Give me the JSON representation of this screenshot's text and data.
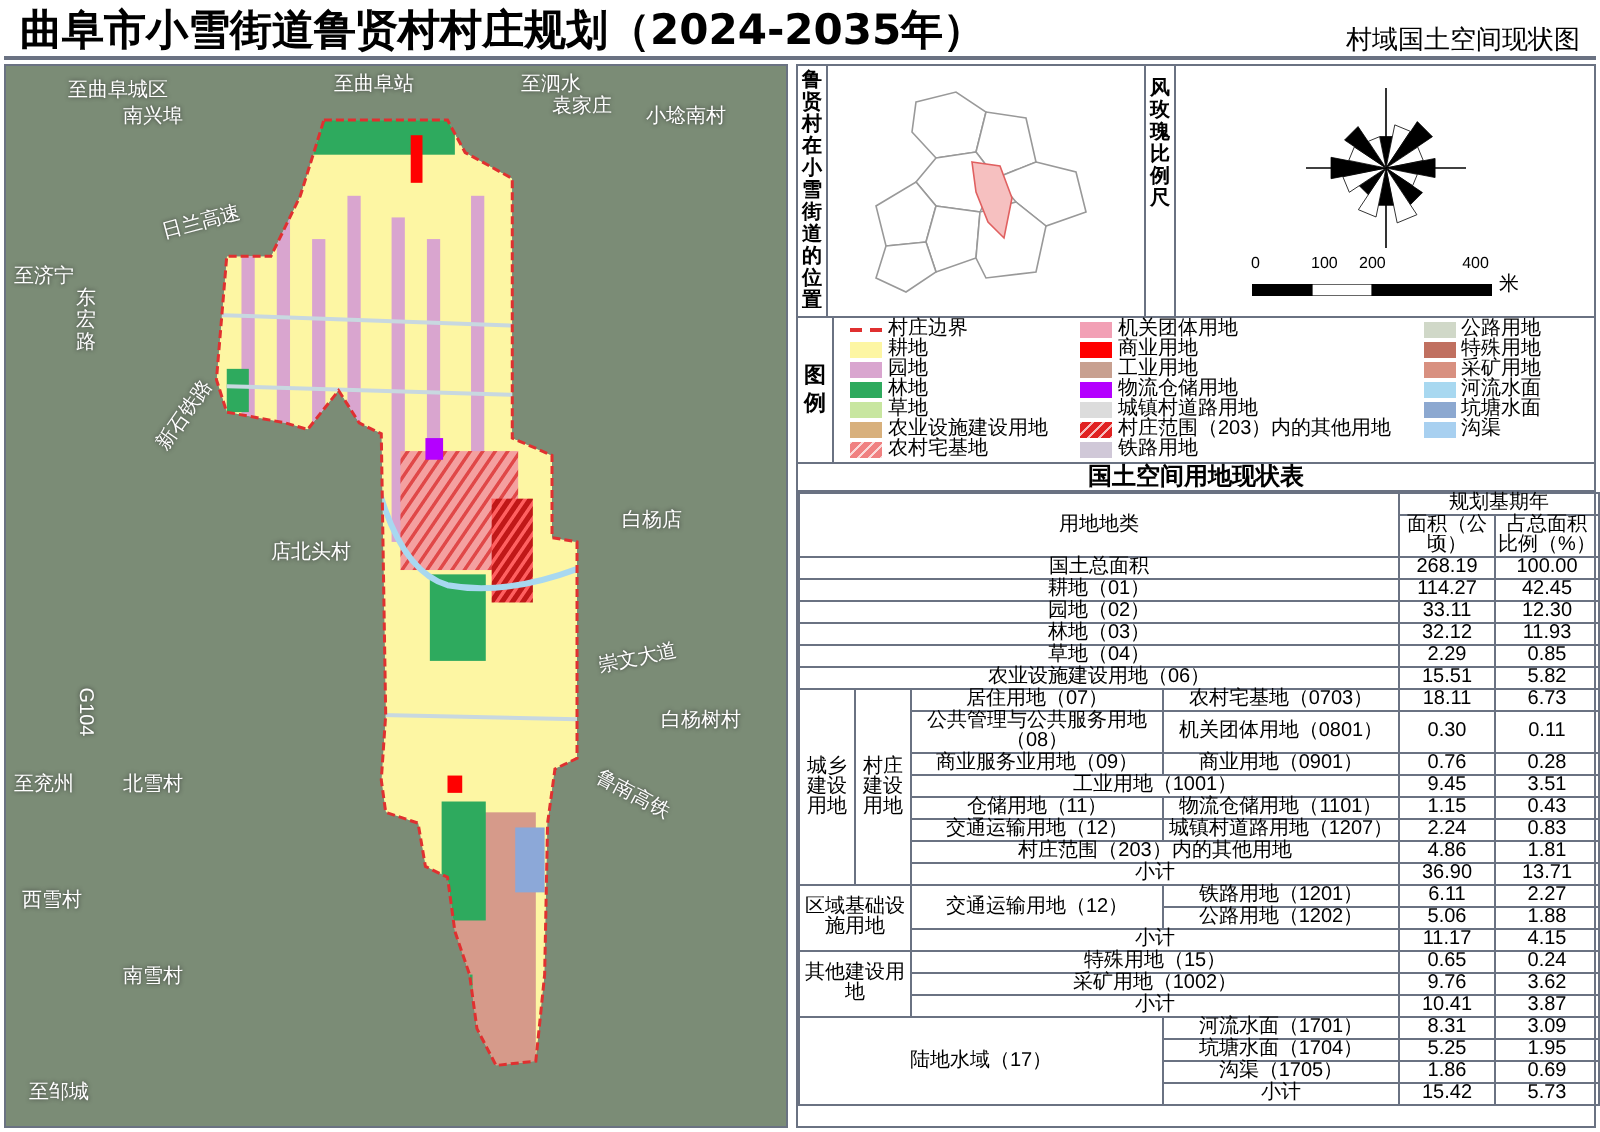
{
  "header": {
    "title": "曲阜市小雪街道鲁贤村村庄规划（2024-2035年）",
    "subtitle": "村域国土空间现状图"
  },
  "map": {
    "labels": [
      "至曲阜城区",
      "南兴埠",
      "至曲阜站",
      "至泗水",
      "袁家庄",
      "小埝南村",
      "日兰高速",
      "至济宁",
      "东宏路",
      "新石铁路",
      "店北头村",
      "白杨店",
      "崇文大道",
      "白杨树村",
      "鲁南高铁",
      "G104",
      "至兖州",
      "北雪村",
      "西雪村",
      "南雪村",
      "至邹城"
    ]
  },
  "locator": {
    "title": "鲁贤村在小雪街道的位置"
  },
  "scale": {
    "title": "风玫瑰比例尺",
    "ticks": [
      "0",
      "100",
      "200",
      "400"
    ],
    "unit": "米"
  },
  "legend": {
    "title": "图例",
    "items": [
      {
        "label": "村庄边界",
        "kind": "boundary",
        "color": "#e03030"
      },
      {
        "label": "耕地",
        "kind": "fill",
        "color": "#fdf6a3"
      },
      {
        "label": "园地",
        "kind": "fill",
        "color": "#d9a5cf"
      },
      {
        "label": "林地",
        "kind": "fill",
        "color": "#2eaa5e"
      },
      {
        "label": "草地",
        "kind": "fill",
        "color": "#c8e6a0"
      },
      {
        "label": "农业设施建设用地",
        "kind": "fill",
        "color": "#d8b07c"
      },
      {
        "label": "农村宅基地",
        "kind": "hatch",
        "color": "#f08080"
      },
      {
        "label": "机关团体用地",
        "kind": "fill",
        "color": "#f2a0b5"
      },
      {
        "label": "商业用地",
        "kind": "fill",
        "color": "#ff0000"
      },
      {
        "label": "工业用地",
        "kind": "fill",
        "color": "#c8a090"
      },
      {
        "label": "物流仓储用地",
        "kind": "fill",
        "color": "#b400ff"
      },
      {
        "label": "城镇村道路用地",
        "kind": "fill",
        "color": "#dcdcdc"
      },
      {
        "label": "村庄范围（203）内的其他用地",
        "kind": "hatch",
        "color": "#e02020"
      },
      {
        "label": "铁路用地",
        "kind": "fill",
        "color": "#d0c8d8"
      },
      {
        "label": "公路用地",
        "kind": "fill",
        "color": "#d0d8c8"
      },
      {
        "label": "特殊用地",
        "kind": "fill",
        "color": "#c07060"
      },
      {
        "label": "采矿用地",
        "kind": "fill",
        "color": "#d89080"
      },
      {
        "label": "河流水面",
        "kind": "fill",
        "color": "#a8d8f0"
      },
      {
        "label": "坑塘水面",
        "kind": "fill",
        "color": "#8ca8d0"
      },
      {
        "label": "沟渠",
        "kind": "fill",
        "color": "#a8d0f0"
      }
    ]
  },
  "table": {
    "title": "国土空间用地现状表",
    "head": {
      "category": "用地地类",
      "period": "规划基期年",
      "area": "面积（公顷）",
      "share": "占总面积比例（%）"
    },
    "sections": [
      {
        "kind": "single",
        "label": "国土总面积",
        "area": "268.19",
        "share": "100.00"
      },
      {
        "kind": "single",
        "label": "耕地（01）",
        "area": "114.27",
        "share": "42.45"
      },
      {
        "kind": "single",
        "label": "园地（02）",
        "area": "33.11",
        "share": "12.30"
      },
      {
        "kind": "single",
        "label": "林地（03）",
        "area": "32.12",
        "share": "11.93"
      },
      {
        "kind": "single",
        "label": "草地（04）",
        "area": "2.29",
        "share": "0.85"
      },
      {
        "kind": "single",
        "label": "农业设施建设用地（06）",
        "area": "15.51",
        "share": "5.82"
      },
      {
        "kind": "nested",
        "label": "城乡建设用地",
        "sublabel": "村庄建设用地",
        "rows": [
          {
            "kind": "pair",
            "label": "居住用地（07）",
            "sublabel": "农村宅基地（0703）",
            "area": "18.11",
            "share": "6.73"
          },
          {
            "kind": "pair",
            "label": "公共管理与公共服务用地（08）",
            "sublabel": "机关团体用地（0801）",
            "area": "0.30",
            "share": "0.11"
          },
          {
            "kind": "pair",
            "label": "商业服务业用地（09）",
            "sublabel": "商业用地（0901）",
            "area": "0.76",
            "share": "0.28"
          },
          {
            "kind": "wide",
            "label": "工业用地（1001）",
            "area": "9.45",
            "share": "3.51"
          },
          {
            "kind": "pair",
            "label": "仓储用地（11）",
            "sublabel": "物流仓储用地（1101）",
            "area": "1.15",
            "share": "0.43"
          },
          {
            "kind": "pair",
            "label": "交通运输用地（12）",
            "sublabel": "城镇村道路用地（1207）",
            "area": "2.24",
            "share": "0.83"
          },
          {
            "kind": "wide",
            "label": "村庄范围（203）内的其他用地",
            "area": "4.86",
            "share": "1.81"
          },
          {
            "kind": "wide",
            "label": "小计",
            "area": "36.90",
            "share": "13.71"
          }
        ]
      },
      {
        "kind": "grouped",
        "label": "区域基础设施用地",
        "rows": [
          {
            "kind": "split",
            "label": "交通运输用地（12）",
            "items": [
              {
                "label": "铁路用地（1201）",
                "area": "6.11",
                "share": "2.27"
              },
              {
                "label": "公路用地（1202）",
                "area": "5.06",
                "share": "1.88"
              }
            ]
          },
          {
            "kind": "wide",
            "label": "小计",
            "area": "11.17",
            "share": "4.15"
          }
        ]
      },
      {
        "kind": "grouped",
        "label": "其他建设用地",
        "rows": [
          {
            "kind": "wide",
            "label": "特殊用地（15）",
            "area": "0.65",
            "share": "0.24"
          },
          {
            "kind": "wide",
            "label": "采矿用地（1002）",
            "area": "9.76",
            "share": "3.62"
          },
          {
            "kind": "wide",
            "label": "小计",
            "area": "10.41",
            "share": "3.87"
          }
        ]
      },
      {
        "kind": "wide_group",
        "label": "陆地水域（17）",
        "rows": [
          {
            "label": "河流水面（1701）",
            "area": "8.31",
            "share": "3.09"
          },
          {
            "label": "坑塘水面（1704）",
            "area": "5.25",
            "share": "1.95"
          },
          {
            "label": "沟渠（1705）",
            "area": "1.86",
            "share": "0.69"
          },
          {
            "label": "小计",
            "area": "15.42",
            "share": "5.73"
          }
        ]
      }
    ]
  }
}
